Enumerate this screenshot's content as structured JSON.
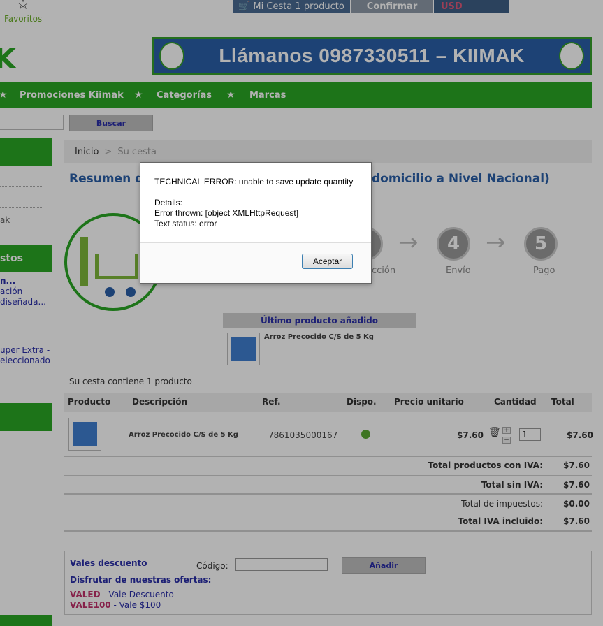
{
  "header": {
    "favoritos": "Favoritos",
    "cart_label": "Mi Cesta 1 producto",
    "confirm": "Confirmar",
    "currency": "USD",
    "logo_letter": "K",
    "banner_text": "Llámanos 0987330511 – KIIMAK"
  },
  "nav": {
    "items": [
      "Promociones Kiimak",
      "Categorías",
      "Marcas"
    ]
  },
  "search": {
    "button": "Buscar"
  },
  "breadcrumb": {
    "home": "Inicio",
    "sep": ">",
    "current": "Su cesta"
  },
  "sidebar": {
    "section2": "stos",
    "link1": "n...",
    "link2": "ación",
    "link3": "diseñada...",
    "link4": "uper Extra -",
    "link5": "eleccionado",
    "link6": "ak"
  },
  "page": {
    "title_left": "Resumen d",
    "title_right": "domicilio a Nivel Nacional)"
  },
  "steps": [
    {
      "num": "",
      "label": "ección"
    },
    {
      "num": "4",
      "label": "Envío"
    },
    {
      "num": "5",
      "label": "Pago"
    }
  ],
  "last_added": {
    "header": "Último producto añadido",
    "name": "Arroz Precocido C/S de 5 Kg"
  },
  "cart": {
    "summary": "Su cesta contiene 1 producto",
    "headers": [
      "Producto",
      "Descripción",
      "Ref.",
      "Dispo.",
      "Precio unitario",
      "Cantidad",
      "Total"
    ],
    "row": {
      "desc": "Arroz Precocido C/S de 5 Kg",
      "ref": "7861035000167",
      "price": "$7.60",
      "qty": "1",
      "total": "$7.60"
    },
    "totals": [
      {
        "label": "Total productos con IVA:",
        "value": "$7.60"
      },
      {
        "label": "Total sin IVA:",
        "value": "$7.60"
      },
      {
        "label": "Total de impuestos:",
        "value": "$0.00"
      },
      {
        "label": "Total IVA incluido:",
        "value": "$7.60"
      }
    ]
  },
  "vouchers": {
    "title": "Vales descuento",
    "code_label": "Código:",
    "add_button": "Añadir",
    "offers_title": "Disfrutar de nuestras ofertas:",
    "offers": [
      {
        "code": "VALED",
        "desc": " - Vale Descuento"
      },
      {
        "code": "VALE100",
        "desc": " - Vale $100"
      }
    ]
  },
  "dialog": {
    "line1": "TECHNICAL ERROR: unable to save update quantity",
    "line2": "Details:",
    "line3": "Error thrown: [object XMLHttpRequest]",
    "line4": "Text status: error",
    "ok": "Aceptar"
  },
  "colors": {
    "green": "#2aa624",
    "blue_text": "#2a2ea8",
    "banner_blue": "#2a5fa8"
  }
}
